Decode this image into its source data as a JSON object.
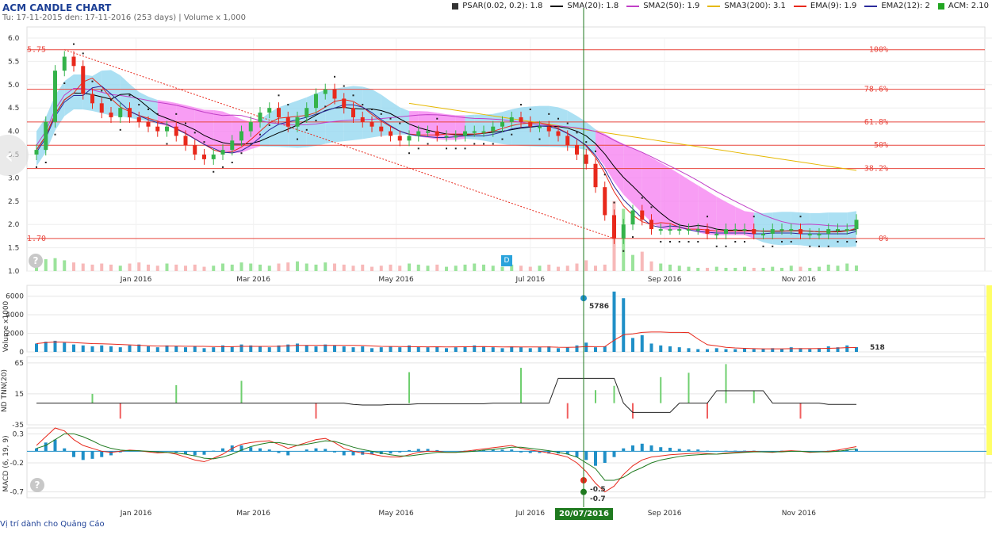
{
  "title": "ACM CANDLE CHART",
  "subtitle": "Tu: 17-11-2015 den: 17-11-2016 (253 days) | Volume x 1,000",
  "legend": [
    {
      "label": "PSAR(0.02, 0.2): 1.8",
      "color": "#333333",
      "kind": "square"
    },
    {
      "label": "SMA(20): 1.8",
      "color": "#000000",
      "kind": "line"
    },
    {
      "label": "SMA2(50): 1.9",
      "color": "#c13fc7",
      "kind": "line"
    },
    {
      "label": "SMA3(200): 3.1",
      "color": "#e6b800",
      "kind": "line"
    },
    {
      "label": "EMA(9): 1.9",
      "color": "#e8291c",
      "kind": "line"
    },
    {
      "label": "EMA2(12): 2",
      "color": "#2b2b9b",
      "kind": "line"
    },
    {
      "label": "ACM: 2.10",
      "color": "#22a622",
      "kind": "square"
    }
  ],
  "footer": "Vị trí dành cho Quảng Cáo",
  "date_badge": "20/07/2016",
  "d_marker": "D",
  "colors": {
    "up": "#34b34a",
    "down": "#e8291c",
    "vol_up": "#9be39b",
    "vol_down": "#f7b9b9",
    "cloud_bull": "#8fd6ef",
    "cloud_bear": "#f57cf0",
    "fib": "#e8463d",
    "crosshair": "#1f7a1f"
  },
  "chart_data": [
    {
      "type": "candlestick",
      "title": "ACM CANDLE CHART",
      "x_ticks": [
        "Jan 2016",
        "Mar 2016",
        "May 2016",
        "Jul 2016",
        "Sep 2016",
        "Nov 2016"
      ],
      "y_ticks": [
        "6.0",
        "5.5",
        "5.0",
        "4.5",
        "4.0",
        "3.5",
        "3.0",
        "2.5",
        "2.0",
        "1.5",
        "1.0"
      ],
      "ylim": [
        1.0,
        6.0
      ],
      "fibonacci": [
        {
          "label": "100%",
          "value": 5.75
        },
        {
          "label": "78.6%",
          "value": 4.9
        },
        {
          "label": "61.8%",
          "value": 4.2
        },
        {
          "label": "50%",
          "value": 3.7
        },
        {
          "label": "38.2%",
          "value": 3.2
        },
        {
          "label": "0%",
          "value": 1.7
        }
      ],
      "left_labels": [
        "5.75",
        "1.70"
      ],
      "close_series": [
        3.6,
        4.2,
        5.3,
        5.6,
        5.4,
        4.8,
        4.6,
        4.4,
        4.3,
        4.5,
        4.3,
        4.2,
        4.1,
        4.0,
        4.1,
        3.9,
        3.7,
        3.5,
        3.4,
        3.5,
        3.6,
        3.8,
        4.0,
        4.2,
        4.4,
        4.5,
        4.3,
        4.1,
        4.3,
        4.5,
        4.8,
        4.9,
        4.7,
        4.5,
        4.3,
        4.2,
        4.1,
        4.0,
        3.9,
        3.8,
        3.9,
        4.0,
        4.0,
        3.9,
        3.9,
        3.9,
        4.0,
        4.0,
        4.0,
        4.1,
        4.2,
        4.3,
        4.2,
        4.1,
        4.1,
        4.0,
        3.9,
        3.7,
        3.5,
        3.3,
        2.8,
        2.2,
        1.7,
        2.0,
        2.3,
        2.1,
        1.9,
        1.9,
        1.9,
        1.9,
        1.9,
        1.9,
        1.8,
        1.8,
        1.9,
        1.9,
        1.9,
        1.8,
        1.8,
        1.9,
        1.9,
        1.9,
        1.8,
        1.8,
        1.8,
        1.9,
        1.9,
        1.9,
        2.1
      ]
    },
    {
      "type": "bar",
      "title": "Volume x1000",
      "ylabel": "Volume x1000",
      "y_ticks": [
        "6000",
        "4000",
        "2000",
        "0"
      ],
      "annotations": [
        {
          "label": "5786",
          "value": 5786
        },
        {
          "label": "518",
          "value": 518
        }
      ],
      "values": [
        900,
        1100,
        1200,
        1000,
        800,
        700,
        600,
        700,
        600,
        500,
        700,
        800,
        600,
        500,
        700,
        600,
        500,
        600,
        400,
        500,
        700,
        600,
        800,
        700,
        600,
        500,
        700,
        800,
        900,
        700,
        600,
        800,
        700,
        600,
        500,
        600,
        400,
        500,
        600,
        500,
        700,
        600,
        500,
        600,
        400,
        500,
        600,
        700,
        600,
        500,
        400,
        600,
        500,
        400,
        500,
        600,
        400,
        500,
        700,
        1000,
        500,
        600,
        6500,
        5786,
        1500,
        1800,
        900,
        700,
        600,
        500,
        400,
        300,
        300,
        400,
        300,
        300,
        400,
        300,
        300,
        400,
        300,
        500,
        400,
        300,
        400,
        600,
        500,
        700,
        518
      ]
    },
    {
      "type": "line",
      "title": "NDTNN(20)",
      "ylabel": "ND TNN(20)",
      "y_ticks": [
        "65",
        "15",
        "-35"
      ],
      "ylim": [
        -35,
        75
      ],
      "values": [
        0,
        0,
        0,
        0,
        0,
        0,
        0,
        0,
        0,
        0,
        0,
        0,
        0,
        0,
        0,
        0,
        0,
        0,
        0,
        0,
        0,
        0,
        0,
        0,
        0,
        0,
        0,
        0,
        0,
        0,
        0,
        0,
        0,
        0,
        -2,
        -3,
        -3,
        -3,
        -2,
        -2,
        -2,
        -1,
        -1,
        -1,
        -1,
        -1,
        -1,
        -1,
        -1,
        0,
        0,
        0,
        0,
        0,
        0,
        0,
        40,
        40,
        40,
        40,
        40,
        40,
        40,
        0,
        -15,
        -15,
        -15,
        -15,
        -15,
        0,
        0,
        0,
        0,
        20,
        20,
        20,
        20,
        20,
        20,
        0,
        0,
        0,
        0,
        0,
        0,
        -2,
        -2,
        -2,
        -2
      ]
    },
    {
      "type": "line",
      "title": "MACD (6, 19, 9)",
      "ylabel": "MACD (6, 19, 9)",
      "y_ticks": [
        "0.3",
        "-0.2",
        "-0.7"
      ],
      "ylim": [
        -0.8,
        0.4
      ],
      "annotations": [
        {
          "label": "-0.5",
          "value": -0.5
        },
        {
          "label": "-0.7",
          "value": -0.7
        }
      ],
      "series": [
        {
          "name": "MACD",
          "values": [
            0.1,
            0.25,
            0.4,
            0.35,
            0.2,
            0.1,
            0.05,
            0.0,
            -0.02,
            0.0,
            0.02,
            0.01,
            -0.01,
            -0.03,
            -0.02,
            -0.05,
            -0.1,
            -0.15,
            -0.18,
            -0.12,
            -0.05,
            0.05,
            0.12,
            0.15,
            0.17,
            0.18,
            0.12,
            0.05,
            0.1,
            0.15,
            0.2,
            0.22,
            0.15,
            0.05,
            0.0,
            -0.03,
            -0.05,
            -0.08,
            -0.1,
            -0.1,
            -0.06,
            -0.02,
            0.0,
            0.0,
            -0.02,
            -0.02,
            0.0,
            0.02,
            0.04,
            0.06,
            0.08,
            0.1,
            0.05,
            0.02,
            0.0,
            -0.03,
            -0.06,
            -0.1,
            -0.2,
            -0.35,
            -0.55,
            -0.7,
            -0.6,
            -0.4,
            -0.25,
            -0.15,
            -0.1,
            -0.08,
            -0.06,
            -0.05,
            -0.04,
            -0.03,
            -0.04,
            -0.05,
            -0.03,
            -0.02,
            -0.01,
            0.0,
            -0.01,
            -0.02,
            0.0,
            0.01,
            0.0,
            -0.02,
            -0.01,
            0.0,
            0.02,
            0.05,
            0.08
          ]
        },
        {
          "name": "Signal",
          "values": [
            0.05,
            0.1,
            0.2,
            0.3,
            0.3,
            0.25,
            0.18,
            0.1,
            0.05,
            0.02,
            0.01,
            0.01,
            0.0,
            -0.01,
            -0.02,
            -0.03,
            -0.05,
            -0.08,
            -0.12,
            -0.13,
            -0.1,
            -0.05,
            0.02,
            0.08,
            0.12,
            0.15,
            0.15,
            0.12,
            0.1,
            0.12,
            0.15,
            0.18,
            0.17,
            0.12,
            0.07,
            0.03,
            0.0,
            -0.03,
            -0.06,
            -0.08,
            -0.08,
            -0.06,
            -0.04,
            -0.02,
            -0.02,
            -0.02,
            -0.01,
            0.0,
            0.02,
            0.03,
            0.05,
            0.07,
            0.07,
            0.05,
            0.03,
            0.01,
            -0.02,
            -0.05,
            -0.1,
            -0.2,
            -0.3,
            -0.5,
            -0.5,
            -0.45,
            -0.35,
            -0.28,
            -0.2,
            -0.15,
            -0.12,
            -0.09,
            -0.07,
            -0.06,
            -0.05,
            -0.05,
            -0.04,
            -0.03,
            -0.02,
            -0.01,
            -0.01,
            -0.01,
            -0.01,
            0.0,
            0.0,
            -0.01,
            -0.01,
            -0.01,
            0.0,
            0.02,
            0.04
          ]
        }
      ],
      "histogram": [
        0.05,
        0.15,
        0.2,
        0.05,
        -0.1,
        -0.15,
        -0.13,
        -0.1,
        -0.07,
        -0.02,
        0.01,
        0.0,
        -0.01,
        -0.02,
        0.0,
        -0.02,
        -0.05,
        -0.07,
        -0.06,
        0.01,
        0.05,
        0.1,
        0.1,
        0.07,
        0.05,
        0.03,
        -0.03,
        -0.07,
        0.0,
        0.03,
        0.05,
        0.04,
        -0.02,
        -0.07,
        -0.07,
        -0.06,
        -0.05,
        -0.05,
        -0.04,
        -0.02,
        0.02,
        0.04,
        0.04,
        0.02,
        0.0,
        0.0,
        0.01,
        0.02,
        0.02,
        0.03,
        0.03,
        0.03,
        -0.02,
        -0.03,
        -0.03,
        -0.04,
        -0.04,
        -0.05,
        -0.1,
        -0.15,
        -0.25,
        -0.2,
        -0.1,
        0.05,
        0.1,
        0.13,
        0.1,
        0.07,
        0.06,
        0.04,
        0.03,
        0.03,
        0.01,
        0.0,
        0.01,
        0.01,
        0.01,
        0.01,
        0.0,
        -0.01,
        0.01,
        0.01,
        0.0,
        -0.01,
        0.0,
        0.01,
        0.02,
        0.03,
        0.04
      ]
    }
  ]
}
